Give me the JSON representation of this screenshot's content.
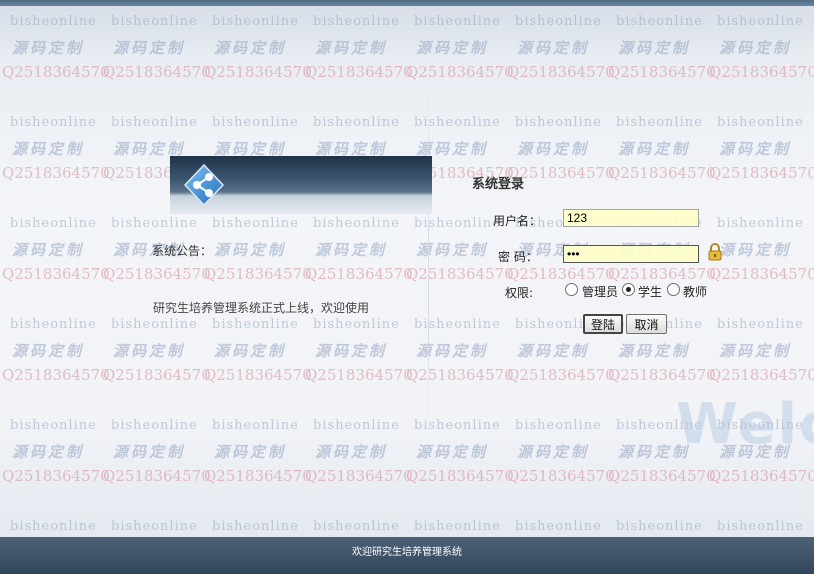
{
  "watermark": {
    "site": "bisheonline",
    "custom": "源码定制",
    "qq": "Q2518364570"
  },
  "notice": {
    "label": "系统公告：",
    "text": "研究生培养管理系统正式上线，欢迎使用"
  },
  "login": {
    "title": "系统登录",
    "username_label": "用户名：",
    "username_value": "123",
    "password_label": "密 码：",
    "password_value": "•••",
    "role_label": "权限:",
    "roles": [
      {
        "label": "管理员",
        "selected": false
      },
      {
        "label": "学生",
        "selected": true
      },
      {
        "label": "教师",
        "selected": false
      }
    ],
    "submit_label": "登陆",
    "cancel_label": "取消"
  },
  "decor": {
    "welcome_text": "Welco"
  },
  "footer": {
    "text": "欢迎研究生培养管理系统"
  },
  "icons": {
    "logo": "share-nodes-icon",
    "lock": "lock-icon"
  },
  "colors": {
    "header_dark": "#1f3348",
    "footer_bg": "#3e5267",
    "input_bg": "#ffffc8"
  }
}
